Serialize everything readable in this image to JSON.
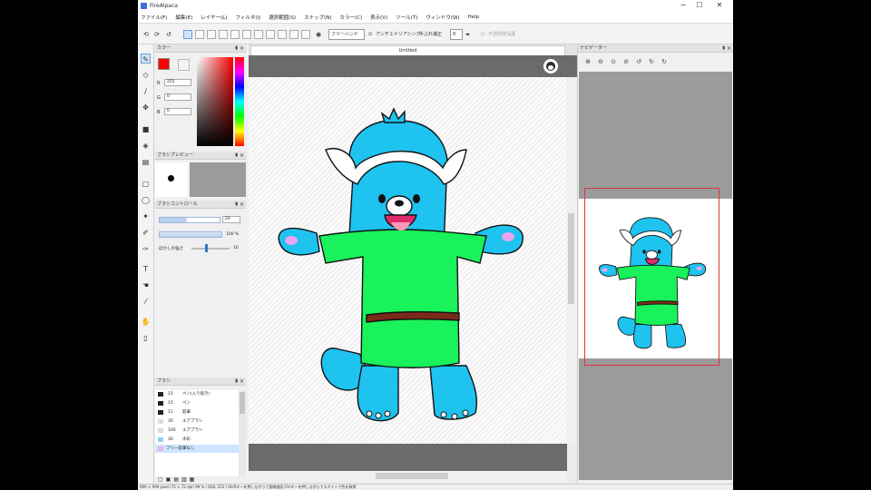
{
  "app": {
    "title": "FireAlpaca",
    "window_controls": {
      "minimize": "−",
      "maximize": "☐",
      "close": "✕"
    }
  },
  "menu": [
    "ファイル(F)",
    "編集(E)",
    "レイヤー(L)",
    "フィルタ(I)",
    "選択範囲(S)",
    "スナップ(N)",
    "カラー(C)",
    "表示(V)",
    "ツール(T)",
    "ウィンドウ(W)",
    "Help"
  ],
  "toolbar": {
    "dropdown_mode": "フリーハンド",
    "antialias": "アンチエイリアシング",
    "correction": "手ぶれ補正",
    "correction_value": "0",
    "transparency": "不透明度保護"
  },
  "color_panel": {
    "title": "カラー",
    "r_label": "R",
    "g_label": "G",
    "b_label": "B",
    "r": "255",
    "g": "0",
    "b": "0",
    "primary": "#ff0000",
    "secondary": "#f2f2f2"
  },
  "brush_preview": {
    "title": "ブラシプレビュー"
  },
  "brush_control": {
    "title": "ブラシコントロール",
    "size": "20",
    "opacity": "100 %",
    "blur_label": "ぼかしの強さ",
    "blur": "10"
  },
  "brush_list": {
    "title": "ブラシ",
    "items": [
      {
        "size": "15",
        "name": "ペン(入り抜き)"
      },
      {
        "size": "15",
        "name": "ペン"
      },
      {
        "size": "11",
        "name": "鉛筆"
      },
      {
        "size": "30",
        "name": "エアブラシ"
      },
      {
        "size": "100",
        "name": "エアブラシ"
      },
      {
        "size": "30",
        "name": "水彩"
      },
      {
        "size": "",
        "name": "フリー鉛筆なし"
      }
    ]
  },
  "canvas": {
    "tab_title": "Untitled"
  },
  "navigator": {
    "title": "ナビゲーター"
  },
  "statusbar": {
    "text": "999 × 999 pixel (72 × 72 dpi)   99 %   ( 638, 223 )   Shiftキーを押しながらで直線描画  Ctrlキーを押しながらでスポイトで色を取得"
  }
}
